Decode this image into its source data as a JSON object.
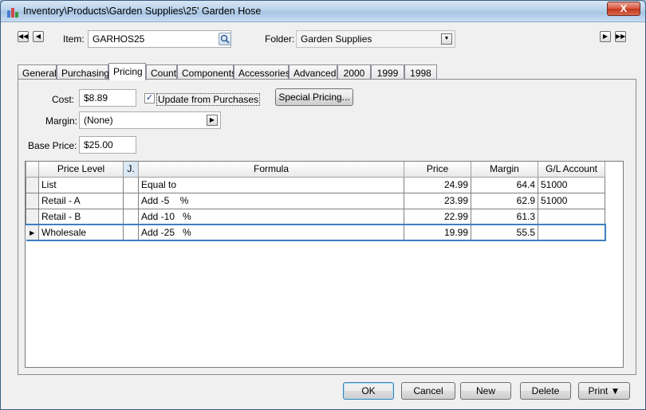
{
  "window": {
    "title": "Inventory\\Products\\Garden Supplies\\25' Garden Hose",
    "close_label": "X"
  },
  "nav": {
    "first": "◀◀",
    "prev": "◀",
    "next": "▶",
    "last": "▶▶"
  },
  "item": {
    "label": "Item:",
    "value": "GARHOS25"
  },
  "folder": {
    "label": "Folder:",
    "value": "Garden Supplies"
  },
  "tabs": [
    "General",
    "Purchasing",
    "Pricing",
    "Count",
    "Components",
    "Accessories",
    "Advanced",
    "2000",
    "1999",
    "1998"
  ],
  "active_tab": "Pricing",
  "pricing": {
    "cost_label": "Cost:",
    "cost_value": "$8.89",
    "update_label": "Update from Purchases",
    "update_checked": true,
    "special_pricing_label": "Special Pricing...",
    "margin_label": "Margin:",
    "margin_value": "(None)",
    "base_price_label": "Base Price:",
    "base_price_value": "$25.00"
  },
  "grid": {
    "columns": [
      "Price Level",
      "J.",
      "Formula",
      "Price",
      "Margin",
      "G/L Account"
    ],
    "rows": [
      {
        "level": "List",
        "j": "",
        "formula": "Equal to",
        "price": "24.99",
        "margin": "64.4",
        "gl": "51000"
      },
      {
        "level": "Retail - A",
        "j": "",
        "formula": "Add -5    %",
        "price": "23.99",
        "margin": "62.9",
        "gl": "51000"
      },
      {
        "level": "Retail - B",
        "j": "",
        "formula": "Add -10   %",
        "price": "22.99",
        "margin": "61.3",
        "gl": ""
      },
      {
        "level": "Wholesale",
        "j": "",
        "formula": "Add -25   %",
        "price": "19.99",
        "margin": "55.5",
        "gl": ""
      }
    ]
  },
  "buttons": {
    "ok": "OK",
    "cancel": "Cancel",
    "new": "New",
    "delete": "Delete",
    "print": "Print ▼"
  }
}
